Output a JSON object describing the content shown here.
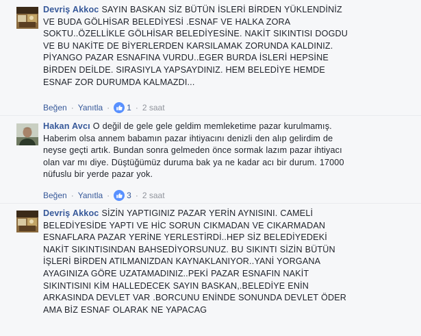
{
  "comments": [
    {
      "author": "Devriş Akkoc",
      "lines": [
        "SAYIN BASKAN SİZ BÜTÜN İSLERİ BİRDEN YÜKLENDİNİZ",
        "VE BUDA GÖLHİSAR BELEDİYESİ .ESNAF VE HALKA ZORA",
        "SOKTU..ÖZELLİKLE GÖLHİSAR BELEDİYESİNE. NAKİT SIKINTISI DOGDU",
        "VE BU NAKİTE DE BİYERLERDEN KARSILAMAK ZORUNDA KALDINIZ.",
        "PİYANGO PAZAR ESNAFINA VURDU..EGER BURDA İSLERİ HEPSİNE",
        "BİRDEN DEİLDE. SIRASIYLA YAPSAYDINIZ. HEM BELEDİYE HEMDE",
        "ESNAF ZOR DURUMDA KALMAZDI..."
      ],
      "like_label": "Beğen",
      "reply_label": "Yanıtla",
      "like_count": "1",
      "time": "2 saat"
    },
    {
      "author": "Hakan Avcı",
      "lines": [
        "O değil de gele gele geldim memleketime pazar kurulmamış.",
        "Haberim olsa annem babamın pazar ihtiyacını denizli den alıp gelirdim de",
        "neyse geçti artık. Bundan sonra gelmeden önce sormak lazım pazar ihtiyacı",
        "olan var mı diye. Düştüğümüz duruma bak ya ne kadar acı bir durum. 17000",
        "nüfuslu bir yerde pazar yok."
      ],
      "like_label": "Beğen",
      "reply_label": "Yanıtla",
      "like_count": "3",
      "time": "2 saat"
    },
    {
      "author": "Devriş Akkoc",
      "lines": [
        "SİZİN YAPTIGINIZ PAZAR YERİN AYNISINI. CAMELİ",
        "BELEDİYESİDE YAPTI VE HİC SORUN CIKMADAN VE CIKARMADAN",
        "ESNAFLARA PAZAR YERİNE YERLESTİRDİ..HEP SİZ BELEDİYEDEKİ",
        "NAKİT SIKINTISINDAN BAHSEDİYORSUNUZ. BU SIKINTI SİZİN BÜTÜN",
        "İŞLERİ BİRDEN ATILMANIZDAN KAYNAKLANIYOR..YANİ YORGANA",
        "AYAGINIZA GÖRE UZATAMADINIZ..PEKİ PAZAR ESNAFIN NAKİT",
        "SIKINTISINI KİM HALLEDECEK SAYIN BASKAN,.BELEDİYE ENİN",
        "ARKASINDA DEVLET VAR .BORCUNU ENİNDE SONUNDA DEVLET ÖDER",
        "AMA BİZ ESNAF OLARAK NE YAPACAG"
      ]
    }
  ],
  "colors": {
    "link": "#365899",
    "meta": "#90949c",
    "text": "#1d2129",
    "like_blue": "#5890ff"
  },
  "icons": {
    "like": "thumbs-up-icon"
  }
}
